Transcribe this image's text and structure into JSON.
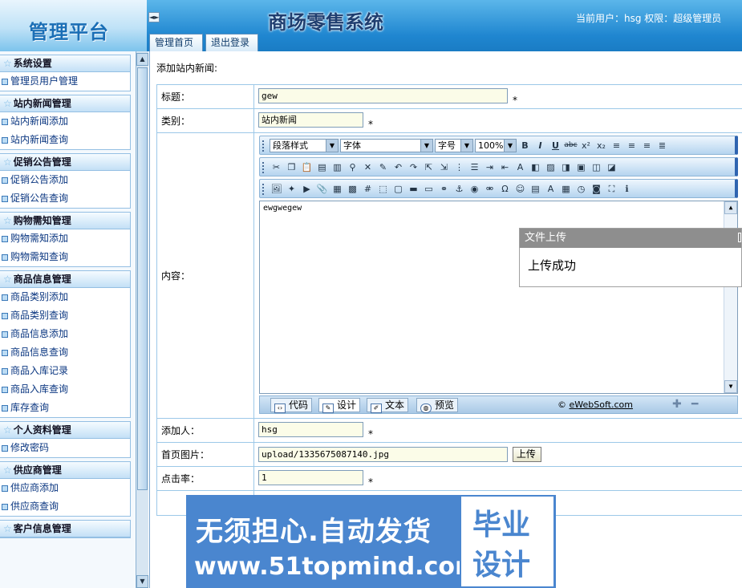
{
  "header": {
    "logo_text": "管理平台",
    "system_title": "商场零售系统",
    "user_info": "当前用户：hsg 权限：超级管理员",
    "collapse_icon": "◄►",
    "nav": {
      "home": "管理首页",
      "logout": "退出登录"
    }
  },
  "sidebar": {
    "groups": [
      {
        "title": "系统设置",
        "items": [
          "管理员用户管理"
        ]
      },
      {
        "title": "站内新闻管理",
        "items": [
          "站内新闻添加",
          "站内新闻查询"
        ]
      },
      {
        "title": "促销公告管理",
        "items": [
          "促销公告添加",
          "促销公告查询"
        ]
      },
      {
        "title": "购物需知管理",
        "items": [
          "购物需知添加",
          "购物需知查询"
        ]
      },
      {
        "title": "商品信息管理",
        "items": [
          "商品类别添加",
          "商品类别查询",
          "商品信息添加",
          "商品信息查询",
          "商品入库记录",
          "商品入库查询",
          "库存查询"
        ]
      },
      {
        "title": "个人资料管理",
        "items": [
          "修改密码"
        ]
      },
      {
        "title": "供应商管理",
        "items": [
          "供应商添加",
          "供应商查询"
        ]
      },
      {
        "title": "客户信息管理",
        "items": []
      }
    ]
  },
  "main": {
    "heading": "添加站内新闻:",
    "form": {
      "title_label": "标题：",
      "title_value": "gew",
      "category_label": "类别：",
      "category_value": "站内新闻",
      "content_label": "内容：",
      "adder_label": "添加人：",
      "adder_value": "hsg",
      "image_label": "首页图片：",
      "image_value": "upload/1335675087140.jpg",
      "upload_button": "上传",
      "clicks_label": "点击率：",
      "clicks_value": "1",
      "required_mark": "*"
    },
    "editor": {
      "paragraph_style": "段落样式",
      "font": "字体",
      "font_size": "字号",
      "zoom": "100%",
      "content": "ewgwegew",
      "modes": {
        "code": "代码",
        "design": "设计",
        "text": "文本",
        "preview": "预览"
      },
      "credit_prefix": "©",
      "credit_link": "eWebSoft.com"
    }
  },
  "popup": {
    "title": "文件上传",
    "message": "上传成功"
  },
  "watermark": {
    "line1": "无须担心.自动发货",
    "line2": "www.51topmind.com",
    "badge_line1": "毕业",
    "badge_line2": "设计"
  }
}
